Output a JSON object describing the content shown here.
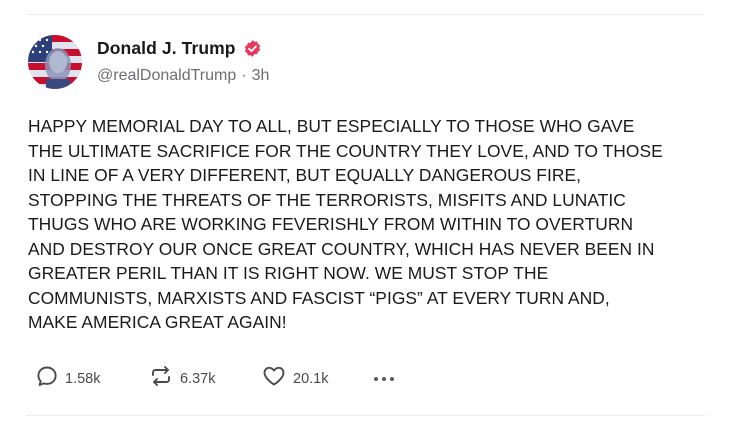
{
  "author": {
    "display_name": "Donald J. Trump",
    "handle": "@realDonaldTrump",
    "time_ago": "3h",
    "separator": "·",
    "verified_color": "#e8365d"
  },
  "post": {
    "text": "HAPPY MEMORIAL DAY TO ALL, BUT ESPECIALLY TO THOSE WHO GAVE\nTHE ULTIMATE SACRIFICE FOR THE COUNTRY THEY LOVE, AND TO THOSE\nIN LINE OF A VERY DIFFERENT, BUT EQUALLY DANGEROUS FIRE,\nSTOPPING THE THREATS OF THE TERRORISTS, MISFITS AND LUNATIC\nTHUGS WHO ARE WORKING FEVERISHLY FROM WITHIN TO OVERTURN\nAND DESTROY OUR ONCE GREAT COUNTRY, WHICH HAS NEVER BEEN IN\nGREATER PERIL THAN IT IS RIGHT NOW. WE MUST STOP THE\nCOMMUNISTS, MARXISTS AND FASCIST “PIGS” AT EVERY TURN AND,\nMAKE AMERICA GREAT AGAIN!"
  },
  "actions": {
    "replies": "1.58k",
    "reposts": "6.37k",
    "likes": "20.1k",
    "reply_icon": "reply-icon",
    "repost_icon": "repost-icon",
    "like_icon": "heart-icon",
    "more_icon": "more-icon"
  }
}
